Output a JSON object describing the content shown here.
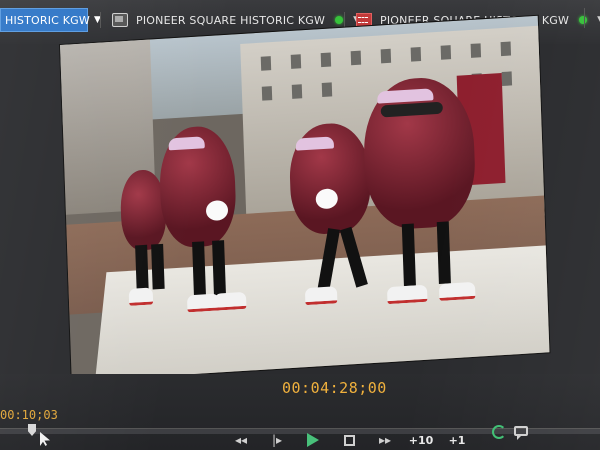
{
  "tabs": [
    {
      "label": "HISTORIC KGW",
      "icon": "none",
      "active": true
    },
    {
      "label": "PIONEER SQUARE HISTORIC KGW",
      "icon": "media-icon",
      "status_color": "#37c23b"
    },
    {
      "label": "PIONEER SQUARE HISTORIC KGW",
      "icon": "film-icon",
      "status_color": "#37c23b"
    }
  ],
  "viewer": {
    "in_timecode": "00:10;03",
    "current_timecode": "00:04:28;00",
    "playhead_fraction": 0.05
  },
  "transport": {
    "step_forward_label": "+10",
    "step_one_label": "+1"
  },
  "colors": {
    "accent": "#2f76c7",
    "timecode": "#f0b13d",
    "play": "#48c07a",
    "status": "#37c23b"
  }
}
